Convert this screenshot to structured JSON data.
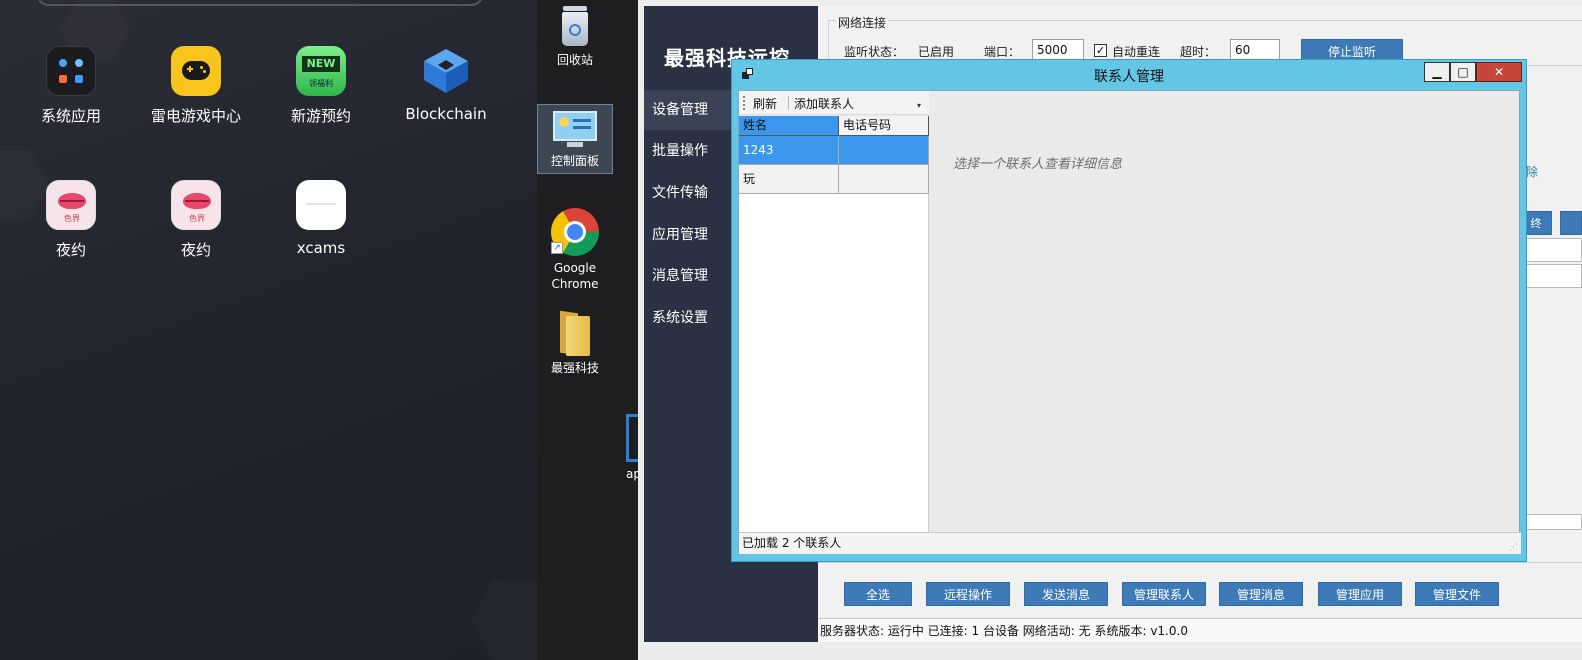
{
  "android": {
    "apps": [
      {
        "label": "系统应用",
        "icon": "folder-grid-icon"
      },
      {
        "label": "雷电游戏中心",
        "icon": "gamepad-icon"
      },
      {
        "label": "新游预约",
        "icon": "new-badge-icon",
        "badge_top": "NEW",
        "badge_bottom": "领福利"
      },
      {
        "label": "Blockchain",
        "icon": "blockchain-cube-icon"
      },
      {
        "label": "夜约",
        "icon": "lips-icon",
        "badge": "色界"
      },
      {
        "label": "夜约",
        "icon": "lips-icon",
        "badge": "色界"
      },
      {
        "label": "xcams",
        "icon": "blank-white-icon"
      }
    ]
  },
  "desktop": {
    "icons": [
      {
        "label": "回收站",
        "icon": "recycle-bin-icon"
      },
      {
        "label": "控制面板",
        "icon": "control-panel-icon"
      },
      {
        "label": "Google Chrome",
        "icon": "chrome-icon"
      },
      {
        "label": "最强科技",
        "icon": "folder-icon"
      }
    ],
    "partial_label": "ap"
  },
  "main": {
    "brand": "最强科技远控",
    "nav": [
      "设备管理",
      "批量操作",
      "文件传输",
      "应用管理",
      "消息管理",
      "系统设置"
    ],
    "active_nav": "设备管理",
    "network": {
      "group_title": "网络连接",
      "listen_status_label": "监听状态：",
      "listen_status_value": "已启用",
      "port_label": "端口：",
      "port_value": "5000",
      "auto_reconnect_label": "自动重连",
      "auto_reconnect_checked": true,
      "timeout_label": "超时：",
      "timeout_value": "60",
      "stop_button": "停止监听"
    },
    "partial_right_text": "除",
    "partial_right_button": "终",
    "actions": [
      "全选",
      "远程操作",
      "发送消息",
      "管理联系人",
      "管理消息",
      "管理应用",
      "管理文件"
    ],
    "status": "服务器状态: 运行中  已连接: 1 台设备  网络活动: 无  系统版本: v1.0.0"
  },
  "dialog": {
    "title": "联系人管理",
    "controls": {
      "minimize": "▁",
      "maximize": "□",
      "close": "✕"
    },
    "toolbar": {
      "refresh": "刷新",
      "add_contact": "添加联系人"
    },
    "columns": [
      "姓名",
      "电话号码"
    ],
    "rows": [
      {
        "name": "1243",
        "phone": "",
        "selected": true
      },
      {
        "name": "玩",
        "phone": "",
        "selected": false
      }
    ],
    "detail_hint": "选择一个联系人查看详细信息",
    "status": "已加载 2 个联系人"
  },
  "colors": {
    "dialog_border": "#63c6e4",
    "selected_row": "#3b97eb",
    "button_blue": "#3d7ab6",
    "sidebar": "#2a3143"
  }
}
